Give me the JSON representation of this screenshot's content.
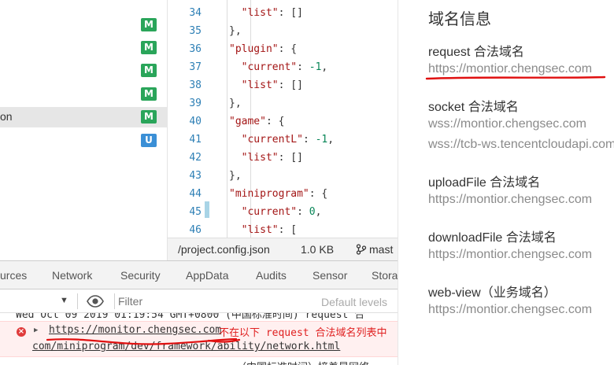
{
  "file_tree": {
    "rows": [
      {
        "label": "",
        "badge": "M",
        "badge_kind": "m",
        "selected": false
      },
      {
        "label": "",
        "badge": "M",
        "badge_kind": "m",
        "selected": false
      },
      {
        "label": "",
        "badge": "M",
        "badge_kind": "m",
        "selected": false
      },
      {
        "label": "",
        "badge": "M",
        "badge_kind": "m",
        "selected": false
      },
      {
        "label": "on",
        "badge": "M",
        "badge_kind": "m",
        "selected": true
      },
      {
        "label": "",
        "badge": "U",
        "badge_kind": "u",
        "selected": false
      }
    ]
  },
  "editor": {
    "lines": [
      {
        "n": "34",
        "segments": [
          [
            "p",
            "  "
          ],
          [
            "key",
            "\"list\""
          ],
          [
            "p",
            ": []"
          ]
        ]
      },
      {
        "n": "35",
        "segments": [
          [
            "p",
            "},"
          ]
        ]
      },
      {
        "n": "36",
        "segments": [
          [
            "key",
            "\"plugin\""
          ],
          [
            "p",
            ": {"
          ]
        ]
      },
      {
        "n": "37",
        "segments": [
          [
            "p",
            "  "
          ],
          [
            "key",
            "\"current\""
          ],
          [
            "p",
            ": "
          ],
          [
            "num",
            "-1"
          ],
          [
            "p",
            ","
          ]
        ]
      },
      {
        "n": "38",
        "segments": [
          [
            "p",
            "  "
          ],
          [
            "key",
            "\"list\""
          ],
          [
            "p",
            ": []"
          ]
        ]
      },
      {
        "n": "39",
        "segments": [
          [
            "p",
            "},"
          ]
        ]
      },
      {
        "n": "40",
        "segments": [
          [
            "key",
            "\"game\""
          ],
          [
            "p",
            ": {"
          ]
        ]
      },
      {
        "n": "41",
        "segments": [
          [
            "p",
            "  "
          ],
          [
            "key",
            "\"currentL\""
          ],
          [
            "p",
            ": "
          ],
          [
            "num",
            "-1"
          ],
          [
            "p",
            ","
          ]
        ]
      },
      {
        "n": "42",
        "segments": [
          [
            "p",
            "  "
          ],
          [
            "key",
            "\"list\""
          ],
          [
            "p",
            ": []"
          ]
        ]
      },
      {
        "n": "43",
        "segments": [
          [
            "p",
            "},"
          ]
        ]
      },
      {
        "n": "44",
        "segments": [
          [
            "key",
            "\"miniprogram\""
          ],
          [
            "p",
            ": {"
          ]
        ]
      },
      {
        "n": "45",
        "segments": [
          [
            "p",
            "  "
          ],
          [
            "key",
            "\"current\""
          ],
          [
            "p",
            ": "
          ],
          [
            "num",
            "0"
          ],
          [
            "p",
            ","
          ]
        ]
      },
      {
        "n": "46",
        "segments": [
          [
            "p",
            "  "
          ],
          [
            "key",
            "\"list\""
          ],
          [
            "p",
            ": ["
          ]
        ]
      }
    ]
  },
  "statusbar": {
    "file_path": "/project.config.json",
    "file_size": "1.0 KB",
    "branch": "mast"
  },
  "devtools_tabs": [
    "urces",
    "Network",
    "Security",
    "AppData",
    "Audits",
    "Sensor",
    "Stora"
  ],
  "console_toolbar": {
    "filter_placeholder": "Filter",
    "levels_label": "Default levels"
  },
  "console": {
    "prev_message": "Wed Oct 09 2019 01:19:54 GMT+0800 (中国标准时间) request 合",
    "error_url": "https://monitor.chengsec.com",
    "error_text": "不在以下 request 合法域名列表中",
    "error_doc_link": "com/miniprogram/dev/framework/ability/network.html",
    "next_message": "（中国标准时间）接着是网络"
  },
  "domain_panel": {
    "title": "域名信息",
    "sections": [
      {
        "label": "request 合法域名",
        "values": [
          "https://montior.chengsec.com"
        ]
      },
      {
        "label": "socket 合法域名",
        "values": [
          "wss://montior.chengsec.com",
          "wss://tcb-ws.tencentcloudapi.com"
        ]
      },
      {
        "label": "uploadFile 合法域名",
        "values": [
          "https://montior.chengsec.com"
        ]
      },
      {
        "label": "downloadFile 合法域名",
        "values": [
          "https://montior.chengsec.com"
        ]
      },
      {
        "label": "web-view（业务域名）",
        "values": [
          "https://montior.chengsec.com"
        ]
      }
    ]
  },
  "colors": {
    "annotation_red": "#e01010",
    "badge_modified": "#2aa55a",
    "badge_untracked": "#3a8fd6",
    "error_text": "#e02020"
  }
}
